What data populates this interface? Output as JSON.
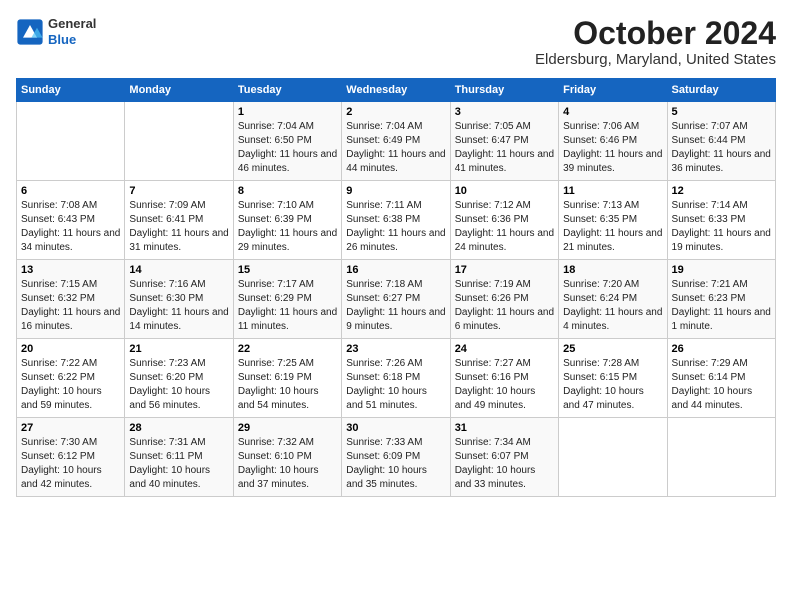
{
  "header": {
    "logo": {
      "general": "General",
      "blue": "Blue"
    },
    "title": "October 2024",
    "subtitle": "Eldersburg, Maryland, United States"
  },
  "days_of_week": [
    "Sunday",
    "Monday",
    "Tuesday",
    "Wednesday",
    "Thursday",
    "Friday",
    "Saturday"
  ],
  "weeks": [
    [
      {
        "day": "",
        "info": ""
      },
      {
        "day": "",
        "info": ""
      },
      {
        "day": "1",
        "info": "Sunrise: 7:04 AM\nSunset: 6:50 PM\nDaylight: 11 hours and 46 minutes."
      },
      {
        "day": "2",
        "info": "Sunrise: 7:04 AM\nSunset: 6:49 PM\nDaylight: 11 hours and 44 minutes."
      },
      {
        "day": "3",
        "info": "Sunrise: 7:05 AM\nSunset: 6:47 PM\nDaylight: 11 hours and 41 minutes."
      },
      {
        "day": "4",
        "info": "Sunrise: 7:06 AM\nSunset: 6:46 PM\nDaylight: 11 hours and 39 minutes."
      },
      {
        "day": "5",
        "info": "Sunrise: 7:07 AM\nSunset: 6:44 PM\nDaylight: 11 hours and 36 minutes."
      }
    ],
    [
      {
        "day": "6",
        "info": "Sunrise: 7:08 AM\nSunset: 6:43 PM\nDaylight: 11 hours and 34 minutes."
      },
      {
        "day": "7",
        "info": "Sunrise: 7:09 AM\nSunset: 6:41 PM\nDaylight: 11 hours and 31 minutes."
      },
      {
        "day": "8",
        "info": "Sunrise: 7:10 AM\nSunset: 6:39 PM\nDaylight: 11 hours and 29 minutes."
      },
      {
        "day": "9",
        "info": "Sunrise: 7:11 AM\nSunset: 6:38 PM\nDaylight: 11 hours and 26 minutes."
      },
      {
        "day": "10",
        "info": "Sunrise: 7:12 AM\nSunset: 6:36 PM\nDaylight: 11 hours and 24 minutes."
      },
      {
        "day": "11",
        "info": "Sunrise: 7:13 AM\nSunset: 6:35 PM\nDaylight: 11 hours and 21 minutes."
      },
      {
        "day": "12",
        "info": "Sunrise: 7:14 AM\nSunset: 6:33 PM\nDaylight: 11 hours and 19 minutes."
      }
    ],
    [
      {
        "day": "13",
        "info": "Sunrise: 7:15 AM\nSunset: 6:32 PM\nDaylight: 11 hours and 16 minutes."
      },
      {
        "day": "14",
        "info": "Sunrise: 7:16 AM\nSunset: 6:30 PM\nDaylight: 11 hours and 14 minutes."
      },
      {
        "day": "15",
        "info": "Sunrise: 7:17 AM\nSunset: 6:29 PM\nDaylight: 11 hours and 11 minutes."
      },
      {
        "day": "16",
        "info": "Sunrise: 7:18 AM\nSunset: 6:27 PM\nDaylight: 11 hours and 9 minutes."
      },
      {
        "day": "17",
        "info": "Sunrise: 7:19 AM\nSunset: 6:26 PM\nDaylight: 11 hours and 6 minutes."
      },
      {
        "day": "18",
        "info": "Sunrise: 7:20 AM\nSunset: 6:24 PM\nDaylight: 11 hours and 4 minutes."
      },
      {
        "day": "19",
        "info": "Sunrise: 7:21 AM\nSunset: 6:23 PM\nDaylight: 11 hours and 1 minute."
      }
    ],
    [
      {
        "day": "20",
        "info": "Sunrise: 7:22 AM\nSunset: 6:22 PM\nDaylight: 10 hours and 59 minutes."
      },
      {
        "day": "21",
        "info": "Sunrise: 7:23 AM\nSunset: 6:20 PM\nDaylight: 10 hours and 56 minutes."
      },
      {
        "day": "22",
        "info": "Sunrise: 7:25 AM\nSunset: 6:19 PM\nDaylight: 10 hours and 54 minutes."
      },
      {
        "day": "23",
        "info": "Sunrise: 7:26 AM\nSunset: 6:18 PM\nDaylight: 10 hours and 51 minutes."
      },
      {
        "day": "24",
        "info": "Sunrise: 7:27 AM\nSunset: 6:16 PM\nDaylight: 10 hours and 49 minutes."
      },
      {
        "day": "25",
        "info": "Sunrise: 7:28 AM\nSunset: 6:15 PM\nDaylight: 10 hours and 47 minutes."
      },
      {
        "day": "26",
        "info": "Sunrise: 7:29 AM\nSunset: 6:14 PM\nDaylight: 10 hours and 44 minutes."
      }
    ],
    [
      {
        "day": "27",
        "info": "Sunrise: 7:30 AM\nSunset: 6:12 PM\nDaylight: 10 hours and 42 minutes."
      },
      {
        "day": "28",
        "info": "Sunrise: 7:31 AM\nSunset: 6:11 PM\nDaylight: 10 hours and 40 minutes."
      },
      {
        "day": "29",
        "info": "Sunrise: 7:32 AM\nSunset: 6:10 PM\nDaylight: 10 hours and 37 minutes."
      },
      {
        "day": "30",
        "info": "Sunrise: 7:33 AM\nSunset: 6:09 PM\nDaylight: 10 hours and 35 minutes."
      },
      {
        "day": "31",
        "info": "Sunrise: 7:34 AM\nSunset: 6:07 PM\nDaylight: 10 hours and 33 minutes."
      },
      {
        "day": "",
        "info": ""
      },
      {
        "day": "",
        "info": ""
      }
    ]
  ]
}
